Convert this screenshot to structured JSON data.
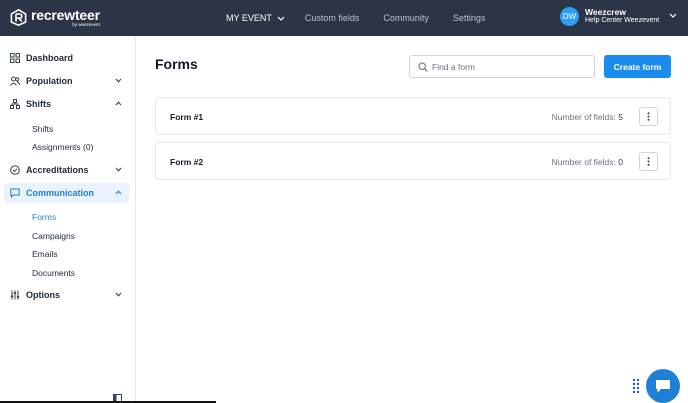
{
  "brand": {
    "name": "recrewteer",
    "sub": "by weezevent"
  },
  "topnav": {
    "items": [
      {
        "label": "MY EVENT",
        "active": true
      },
      {
        "label": "Custom fields"
      },
      {
        "label": "Community"
      },
      {
        "label": "Settings"
      }
    ]
  },
  "user": {
    "initials": "DW",
    "name": "Weezcrew",
    "subtitle": "Help Center Weezevent"
  },
  "sidebar": {
    "items": [
      {
        "label": "Dashboard",
        "icon": "grid-icon"
      },
      {
        "label": "Population",
        "icon": "people-icon"
      },
      {
        "label": "Shifts",
        "icon": "hierarchy-icon"
      },
      {
        "label": "Accreditations",
        "icon": "check-circle-icon"
      },
      {
        "label": "Communication",
        "icon": "message-icon"
      },
      {
        "label": "Options",
        "icon": "sliders-icon"
      }
    ],
    "shifts_sub": [
      "Shifts",
      "Assignments (0)"
    ],
    "communication_sub": [
      "Forms",
      "Campaigns",
      "Emails",
      "Documents"
    ]
  },
  "main": {
    "title": "Forms",
    "search_placeholder": "Find a form",
    "create_label": "Create form",
    "forms": [
      {
        "name": "Form #1",
        "count_label": "Number of fields:",
        "count": "5"
      },
      {
        "name": "Form #2",
        "count_label": "Number of fields:",
        "count": "0"
      }
    ]
  },
  "colors": {
    "topbar": "#2c3547",
    "accent": "#1a8cf0",
    "active_bg": "#eaf3fd",
    "avatar": "#2b9ff0"
  }
}
